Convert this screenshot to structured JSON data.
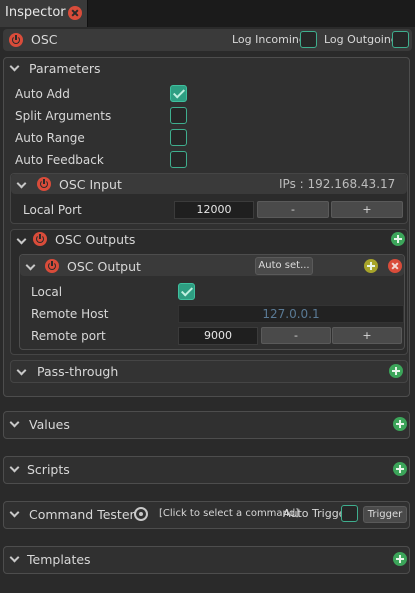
{
  "tab": {
    "label": "Inspector"
  },
  "osc": {
    "title": "OSC",
    "log_incoming": "Log Incoming",
    "log_outgoing": "Log Outgoing"
  },
  "parameters": {
    "title": "Parameters",
    "items": [
      {
        "label": "Auto Add",
        "checked": true
      },
      {
        "label": "Split Arguments",
        "checked": false
      },
      {
        "label": "Auto Range",
        "checked": false
      },
      {
        "label": "Auto Feedback",
        "checked": false
      }
    ]
  },
  "osc_input": {
    "title": "OSC Input",
    "ips": "IPs : 192.168.43.17",
    "local_port_label": "Local Port",
    "local_port_value": "12000",
    "minus": "-",
    "plus": "+"
  },
  "osc_outputs": {
    "title": "OSC Outputs",
    "output": {
      "title": "OSC Output",
      "auto_set": "Auto set...",
      "local_label": "Local",
      "local_checked": true,
      "remote_host_label": "Remote Host",
      "remote_host_value": "127.0.0.1",
      "remote_port_label": "Remote port",
      "remote_port_value": "9000",
      "minus": "-",
      "plus": "+"
    }
  },
  "pass_through": {
    "title": "Pass-through"
  },
  "values": {
    "title": "Values"
  },
  "scripts": {
    "title": "Scripts"
  },
  "command_tester": {
    "title": "Command Tester",
    "command_placeholder": "[Click to select a command]",
    "auto_trigger": "Auto Trigger",
    "trigger": "Trigger"
  },
  "templates": {
    "title": "Templates"
  },
  "colors": {
    "accent_teal": "#2e9e82",
    "power_red": "#d94c3a",
    "add_green": "#3ca55a",
    "background": "#2a2a2a"
  }
}
